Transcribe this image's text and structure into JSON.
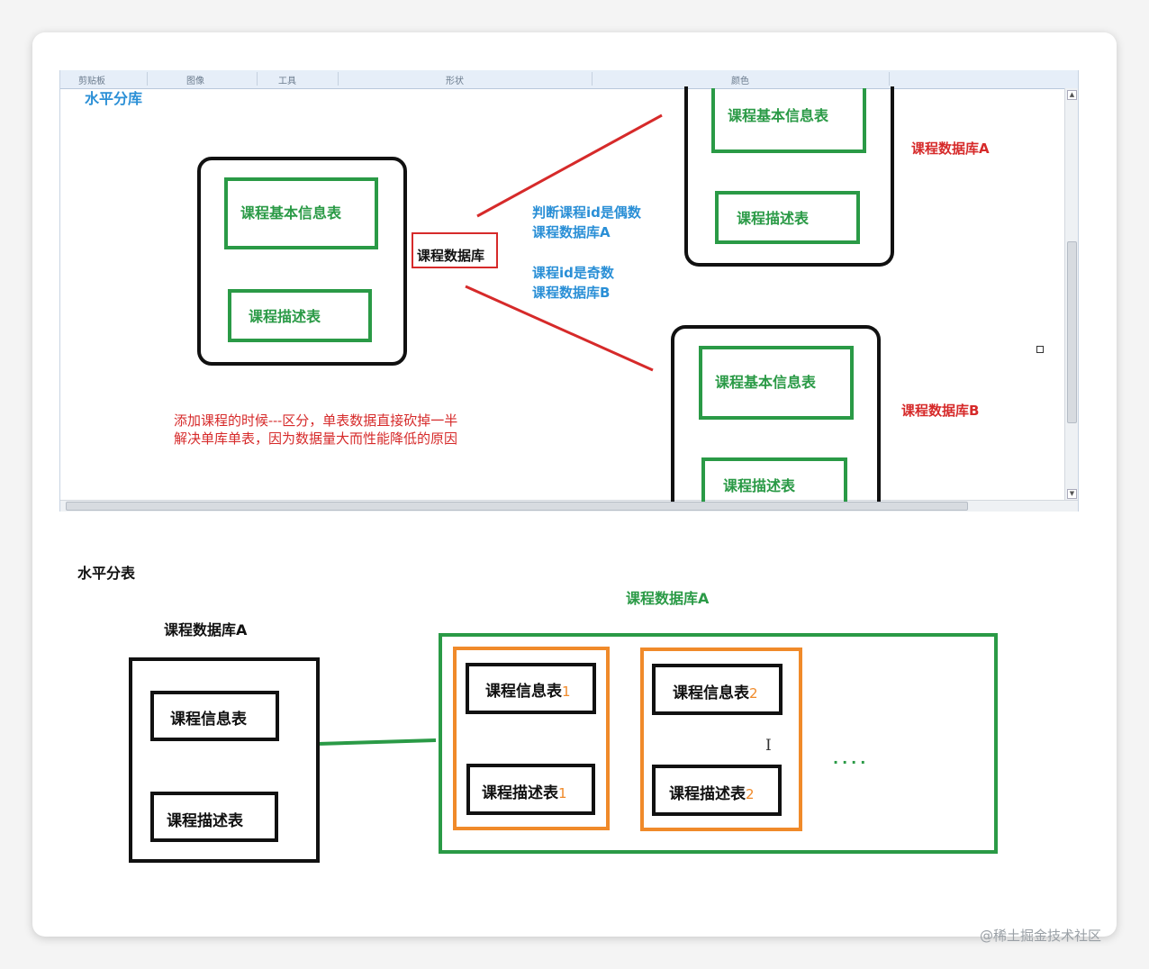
{
  "ribbon": {
    "clipboard": "剪贴板",
    "image": "图像",
    "tools": "工具",
    "shapes": "形状",
    "colors": "颜色"
  },
  "top": {
    "section_title": "水平分库",
    "left_db": {
      "table1": "课程基本信息表",
      "table2": "课程描述表"
    },
    "center_db": "课程数据库",
    "even_rule": [
      "判断课程id是偶数",
      "课程数据库A"
    ],
    "odd_rule": [
      "课程id是奇数",
      "课程数据库B"
    ],
    "db_a": {
      "label": "课程数据库A",
      "table1": "课程基本信息表",
      "table2": "课程描述表"
    },
    "db_b": {
      "label": "课程数据库B",
      "table1": "课程基本信息表",
      "table2": "课程描述表"
    },
    "note": [
      "添加课程的时候---区分，单表数据直接砍掉一半",
      "解决单库单表，因为数据量大而性能降低的原因"
    ]
  },
  "bottom": {
    "section_title": "水平分表",
    "left_db_label": "课程数据库A",
    "left_table1": "课程信息表",
    "left_table2": "课程描述表",
    "right_db_label": "课程数据库A",
    "shard1_info": "课程信息表",
    "shard1_info_sub": "1",
    "shard1_desc": "课程描述表",
    "shard1_desc_sub": "1",
    "shard2_info": "课程信息表",
    "shard2_info_sub": "2",
    "shard2_desc": "课程描述表",
    "shard2_desc_sub": "2",
    "ellipsis": "....",
    "cursor": "I"
  },
  "watermark": "@稀土掘金技术社区",
  "colors": {
    "green": "#2a9a46",
    "red": "#d62a2a",
    "blue": "#2a8fd6",
    "orange": "#f08a2a",
    "black": "#111111"
  }
}
